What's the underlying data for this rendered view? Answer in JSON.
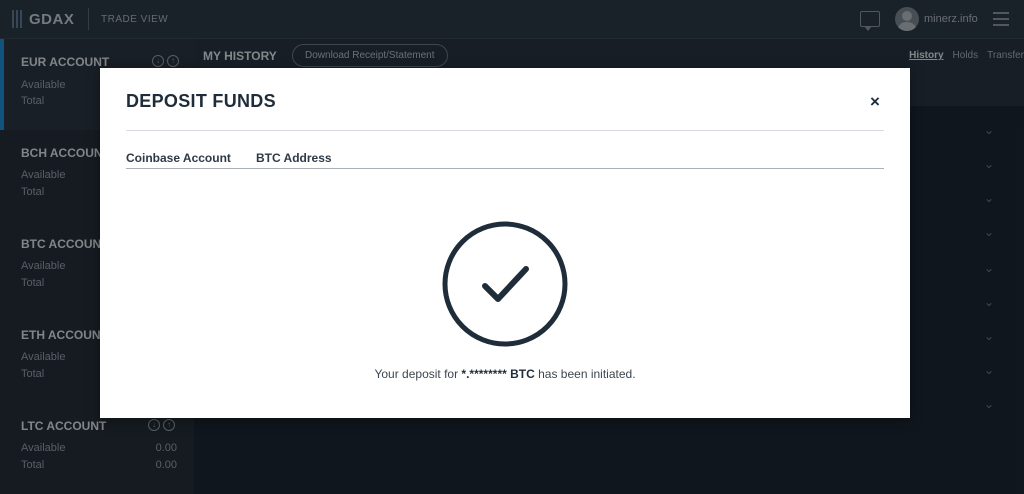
{
  "header": {
    "logo_text": "GDAX",
    "trade_view_label": "TRADE VIEW",
    "username": "minerz.info"
  },
  "sidebar": {
    "accounts": [
      {
        "title": "EUR ACCOUNT",
        "available_label": "Available",
        "total_label": "Total",
        "available": "",
        "total": ""
      },
      {
        "title": "BCH ACCOUNT",
        "available_label": "Available",
        "total_label": "Total",
        "available": "",
        "total": ""
      },
      {
        "title": "BTC ACCOUNT",
        "available_label": "Available",
        "total_label": "Total",
        "available": "",
        "total": ""
      },
      {
        "title": "ETH ACCOUNT",
        "available_label": "Available",
        "total_label": "Total",
        "available": "",
        "total": ""
      },
      {
        "title": "LTC ACCOUNT",
        "available_label": "Available",
        "total_label": "Total",
        "available": "0.00",
        "total": "0.00"
      }
    ]
  },
  "main": {
    "title": "MY HISTORY",
    "download_button": "Download Receipt/Statement",
    "tabs": [
      "History",
      "Holds",
      "Transfer"
    ]
  },
  "modal": {
    "title": "DEPOSIT FUNDS",
    "close": "×",
    "tabs": [
      "Coinbase Account",
      "BTC Address"
    ],
    "message_prefix": "Your deposit for ",
    "message_amount": "*.******** BTC",
    "message_suffix": " has been initiated."
  },
  "colors": {
    "accent": "#1e8fd6",
    "check_circle": "#1f2d3a"
  }
}
